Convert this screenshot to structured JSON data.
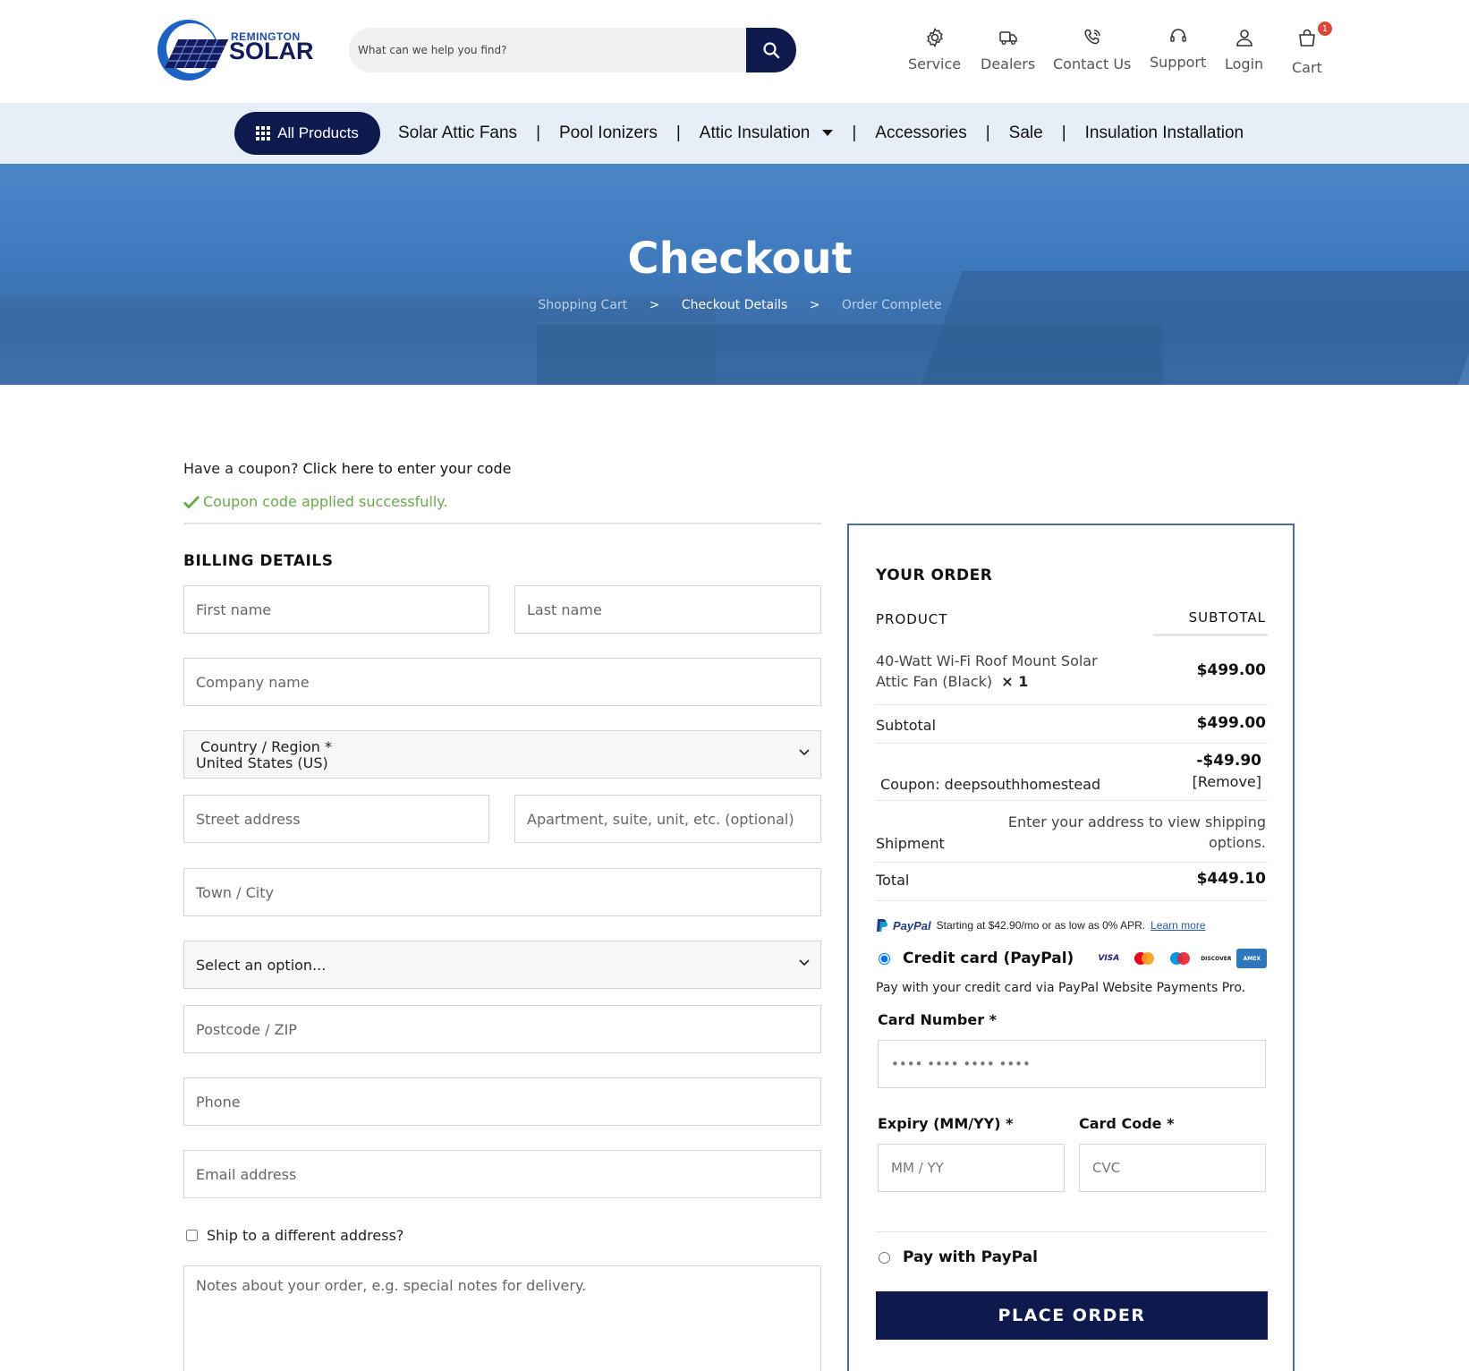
{
  "brand": {
    "top": "REMINGTON",
    "main": "SOLAR"
  },
  "search": {
    "placeholder": "What can we help you find?"
  },
  "header_nav": [
    {
      "label": "Service",
      "icon": "gear-icon"
    },
    {
      "label": "Dealers",
      "icon": "truck-icon"
    },
    {
      "label": "Contact Us",
      "icon": "phone-icon"
    },
    {
      "label": "Support",
      "icon": "headset-icon"
    },
    {
      "label": "Login",
      "icon": "user-icon"
    },
    {
      "label": "Cart",
      "icon": "bag-icon",
      "badge": "1"
    }
  ],
  "nav": {
    "all_products": "All Products",
    "links": [
      "Solar Attic Fans",
      "Pool Ionizers",
      "Attic Insulation",
      "Accessories",
      "Sale",
      "Insulation Installation"
    ],
    "separator": "|"
  },
  "hero": {
    "title": "Checkout",
    "breadcrumb": [
      "Shopping Cart",
      "Checkout Details",
      "Order Complete"
    ],
    "arrow": ">"
  },
  "coupon": {
    "prompt": "Have a coupon?",
    "link": "Click here to enter your code",
    "success": "Coupon code applied successfully."
  },
  "billing": {
    "title": "BILLING DETAILS",
    "first_name": "First name",
    "last_name": "Last name",
    "company": "Company name",
    "country_label": "Country / Region *",
    "country_value": "United States (US)",
    "street": "Street address",
    "apartment": "Apartment, suite, unit, etc. (optional)",
    "city": "Town / City",
    "state": "Select an option...",
    "postcode": "Postcode / ZIP",
    "phone": "Phone",
    "email": "Email address",
    "ship_different": "Ship to a different address?",
    "notes": "Notes about your order, e.g. special notes for delivery."
  },
  "order": {
    "title": "YOUR ORDER",
    "col_product": "PRODUCT",
    "col_subtotal": "SUBTOTAL",
    "item_name_1": "40-Watt Wi-Fi Roof Mount Solar",
    "item_name_2": "Attic Fan (Black)",
    "item_qty": "× 1",
    "item_price": "$499.00",
    "subtotal_label": "Subtotal",
    "subtotal_value": "$499.00",
    "coupon_label": "Coupon: deepsouthhomestead",
    "coupon_value": "-$49.90",
    "coupon_remove": "[Remove]",
    "shipment_label": "Shipment",
    "shipment_value_1": "Enter your address to view shipping",
    "shipment_value_2": "options.",
    "total_label": "Total",
    "total_value": "$449.10"
  },
  "payment": {
    "paypal_brand": "PayPal",
    "paypal_msg": "Starting at $42.90/mo or as low as 0% APR.",
    "learn_more": "Learn more",
    "credit_label": "Credit card (PayPal)",
    "cards": [
      "VISA",
      "MC",
      "Maestro",
      "DISCOVER",
      "AMEX"
    ],
    "description": "Pay with your credit card via PayPal Website Payments Pro.",
    "card_number_label": "Card Number *",
    "card_number_placeholder": "•••• •••• •••• ••••",
    "expiry_label": "Expiry (MM/YY) *",
    "expiry_placeholder": "MM / YY",
    "code_label": "Card Code *",
    "code_placeholder": "CVC",
    "paypal_label": "Pay with PayPal",
    "place_order": "PLACE ORDER"
  },
  "colors": {
    "navy": "#0e1a4d",
    "nav_bg": "#e6eef8",
    "success": "#6aa84f",
    "panel_border": "#4a6fa5"
  }
}
